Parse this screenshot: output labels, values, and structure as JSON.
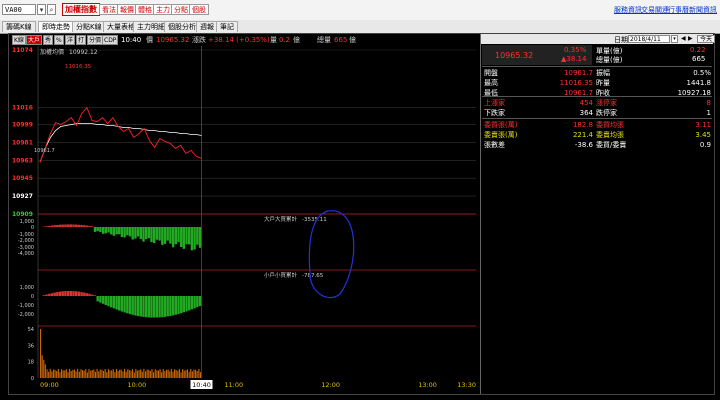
{
  "topbar": {
    "symbol": "VA00",
    "index_name": "加權指數",
    "buttons": [
      "看法",
      "報價",
      "體格",
      "主力",
      "分點",
      "個股"
    ],
    "links": [
      "服務資訊",
      "交易關連",
      "行事曆",
      "新聞資訊"
    ]
  },
  "tabs": [
    "籌碼K線",
    "即時走勢",
    "分點K線",
    "大量表格",
    "主力明細",
    "個股分析",
    "週報",
    "筆記"
  ],
  "active_tab": "即時走勢",
  "toolbar": {
    "buttons": [
      "K線",
      "大戶",
      "秀",
      "%",
      "洋",
      "打",
      "分價",
      "CDP"
    ],
    "time": "10:40",
    "price_label": "價",
    "price": "10965.32",
    "change_label": "漲跌",
    "change": "+38.14 (+0.35%)",
    "volume_label": "量",
    "volume": "0.2",
    "volume_unit": "億",
    "total_label": "總量",
    "total": "665",
    "total_unit": "億"
  },
  "chart": {
    "title": "加權均價",
    "avg_value": "10992.12",
    "high_marker": "11016.35",
    "low_marker": "10961.7",
    "y_labels": [
      "11074",
      "11016",
      "10999",
      "10981",
      "10963",
      "10945",
      "10927",
      "10909"
    ],
    "y_ticks": [
      11074,
      11016,
      10999,
      10981,
      10963,
      10945,
      10927,
      10909
    ],
    "big_label": "大戶大買累計",
    "big_value": "-3535.11",
    "big_ticks": [
      "1,000",
      "0",
      "-1,000",
      "-2,000",
      "-3,000",
      "-4,000"
    ],
    "small_label": "小戶小買累計",
    "small_value": "-787.65",
    "small_ticks": [
      "1,000",
      "0",
      "-1,000",
      "-2,000"
    ],
    "vol_ticks": [
      "54",
      "36",
      "18",
      "0"
    ],
    "x_labels": [
      "09:00",
      "10:00",
      "10:40",
      "11:00",
      "12:00",
      "13:00",
      "13:30"
    ],
    "current_time_label": "10:40",
    "colors": {
      "up": "#ff2020",
      "down": "#22aa22",
      "avg": "#ffffff",
      "accent": "#ff0000"
    },
    "price_series": [
      10961,
      10975,
      10990,
      11001,
      10999,
      11002,
      11006,
      10998,
      11010,
      11016,
      11003,
      11002,
      11006,
      11000,
      11006,
      10997,
      10992,
      10995,
      10986,
      10990,
      10995,
      10983,
      10976,
      10985,
      10982,
      10980,
      10975,
      10978,
      10970,
      10973,
      10967,
      10965
    ],
    "avg_series": [
      10961,
      10975,
      10986,
      10993,
      10997,
      10998,
      10999,
      11000,
      11000,
      11000,
      11000,
      10999,
      10999,
      10998,
      10998,
      10997,
      10996,
      10996,
      10995,
      10995,
      10994,
      10993,
      10993,
      10992,
      10992,
      10991,
      10991,
      10990,
      10990,
      10989,
      10989,
      10988
    ]
  },
  "date_bar": {
    "label": "日期:",
    "date": "2018/4/11",
    "today": "今天"
  },
  "panel": {
    "top_left": "10965.32",
    "top_pct": "0.35%",
    "top_change": "▲38.14",
    "rows": [
      {
        "k": "單量(億)",
        "v": "0.22",
        "vc": "#ff3030"
      },
      {
        "k": "總量(億)",
        "v": "665",
        "vc": "#ffffff"
      }
    ],
    "stats": [
      {
        "k": "開盤",
        "v": "10961.7",
        "vc": "#ff3030",
        "k2": "振幅",
        "v2": "0.5%",
        "v2c": "#ffffff"
      },
      {
        "k": "最高",
        "v": "11016.35",
        "vc": "#ff3030",
        "k2": "昨量",
        "v2": "1441.8",
        "v2c": "#ffffff"
      },
      {
        "k": "最低",
        "v": "10961.7",
        "vc": "#ff3030",
        "k2": "昨收",
        "v2": "10927.18",
        "v2c": "#ffffff"
      }
    ],
    "updown": [
      {
        "k": "上漲家",
        "kc": "#ff3030",
        "v": "454",
        "vc": "#ff3030",
        "k2": "漲停家",
        "k2c": "#ff3030",
        "v2": "8",
        "v2c": "#ff3030"
      },
      {
        "k": "下跌家",
        "kc": "#ffffff",
        "v": "364",
        "vc": "#ffffff",
        "k2": "跌停家",
        "k2c": "#ffffff",
        "v2": "1",
        "v2c": "#ffffff"
      }
    ],
    "orders": [
      {
        "k": "委買張(萬)",
        "kc": "#ff3030",
        "v": "182.8",
        "vc": "#ff3030",
        "k2": "委買均張",
        "k2c": "#ff3030",
        "v2": "3.11",
        "v2c": "#ff3030"
      },
      {
        "k": "委賣張(萬)",
        "kc": "#e0e000",
        "v": "221.4",
        "vc": "#e0e000",
        "k2": "委賣均張",
        "k2c": "#e0e000",
        "v2": "3.45",
        "v2c": "#e0e000"
      },
      {
        "k": "張數差",
        "kc": "#ffffff",
        "v": "-38.6",
        "vc": "#ffffff",
        "k2": "委買/委賣",
        "k2c": "#ffffff",
        "v2": "0.9",
        "v2c": "#ffffff"
      }
    ]
  }
}
